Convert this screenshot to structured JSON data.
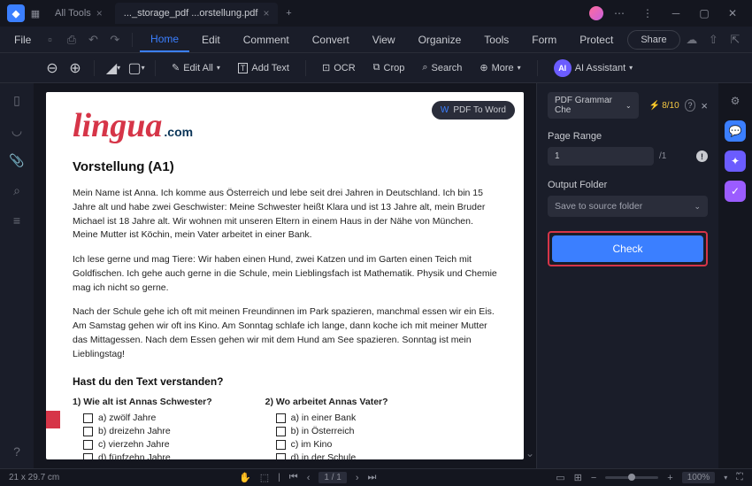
{
  "titlebar": {
    "tabs": [
      {
        "label": "All Tools",
        "active": false
      },
      {
        "label": "..._storage_pdf ...orstellung.pdf",
        "active": true
      }
    ]
  },
  "menubar": {
    "file": "File",
    "tabs": [
      "Home",
      "Edit",
      "Comment",
      "Convert",
      "View",
      "Organize",
      "Tools",
      "Form",
      "Protect"
    ],
    "active": "Home",
    "share": "Share"
  },
  "toolbar": {
    "editAll": "Edit All",
    "addText": "Add Text",
    "ocr": "OCR",
    "crop": "Crop",
    "search": "Search",
    "more": "More",
    "ai": "AI Assistant"
  },
  "page": {
    "pdfToWord": "PDF To Word",
    "logo_main": "lingua",
    "logo_suffix": ".com",
    "h1": "Vorstellung (A1)",
    "p1": "Mein Name ist Anna. Ich komme aus Österreich und lebe seit drei Jahren in Deutschland. Ich bin 15 Jahre alt und habe zwei Geschwister: Meine Schwester heißt Klara und ist 13 Jahre alt, mein Bruder Michael ist 18 Jahre alt. Wir wohnen mit unseren Eltern in einem Haus in der Nähe von München. Meine Mutter ist Köchin, mein Vater arbeitet in einer Bank.",
    "p2": "Ich lese gerne und mag Tiere: Wir haben einen Hund, zwei Katzen und im Garten einen Teich mit Goldfischen. Ich gehe auch gerne in die Schule, mein Lieblingsfach ist Mathematik. Physik und Chemie mag ich nicht so gerne.",
    "p3": "Nach der Schule gehe ich oft mit meinen Freundinnen im Park spazieren, manchmal essen wir ein Eis. Am Samstag gehen wir oft ins Kino. Am Sonntag schlafe ich lange, dann koche ich mit meiner Mutter das Mittagessen. Nach dem Essen gehen wir mit dem Hund am See spazieren. Sonntag ist mein Lieblingstag!",
    "h2": "Hast du den Text verstanden?",
    "q1": {
      "num": "1)",
      "title": "Wie alt ist Annas Schwester?",
      "opts": [
        "a) zwölf Jahre",
        "b) dreizehn Jahre",
        "c) vierzehn Jahre",
        "d) fünfzehn Jahre"
      ]
    },
    "q2": {
      "num": "2)",
      "title": "Wo arbeitet Annas Vater?",
      "opts": [
        "a) in einer Bank",
        "b) in Österreich",
        "c) im Kino",
        "d) in der Schule"
      ]
    }
  },
  "panel": {
    "dropdown": "PDF Grammar Che",
    "credits": "8/10",
    "pageRange": "Page Range",
    "pageValue": "1",
    "pageTotal": "/1",
    "outputFolder": "Output Folder",
    "outputValue": "Save to source folder",
    "check": "Check"
  },
  "status": {
    "dim": "21 x 29.7 cm",
    "page": "1 / 1",
    "zoom": "100%"
  }
}
